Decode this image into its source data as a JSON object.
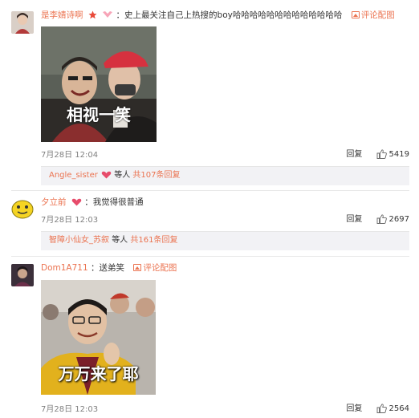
{
  "comments": [
    {
      "username": "是李婧诗啊",
      "text": "史上最关注自己上热搜的boy哈哈哈哈哈哈哈哈哈哈哈哈哈",
      "pic_link": "评论配图",
      "image_caption": "相视一笑",
      "time": "7月28日 12:04",
      "reply": "回复",
      "likes": "5419",
      "sub": {
        "user": "Angle_sister",
        "mid": "等人",
        "total": "共107条回复"
      }
    },
    {
      "username": "夕立前",
      "text": "我觉得很普通",
      "time": "7月28日 12:03",
      "reply": "回复",
      "likes": "2697",
      "sub": {
        "user": "智障小仙女_苏叙",
        "mid": "等人",
        "total": "共161条回复"
      }
    },
    {
      "username": "Dom1A711",
      "text": "送弟笑",
      "pic_link": "评论配图",
      "image_caption": "万万来了耶",
      "time": "7月28日 12:03",
      "reply": "回复",
      "likes": "2564"
    }
  ],
  "colors": {
    "accent": "#eb7350",
    "text": "#333333",
    "meta": "#808080",
    "subbox_bg": "#f2f2f5"
  },
  "icons": [
    "heart-badge-icon",
    "star-badge-icon",
    "picture-icon",
    "thumbs-up-icon"
  ]
}
